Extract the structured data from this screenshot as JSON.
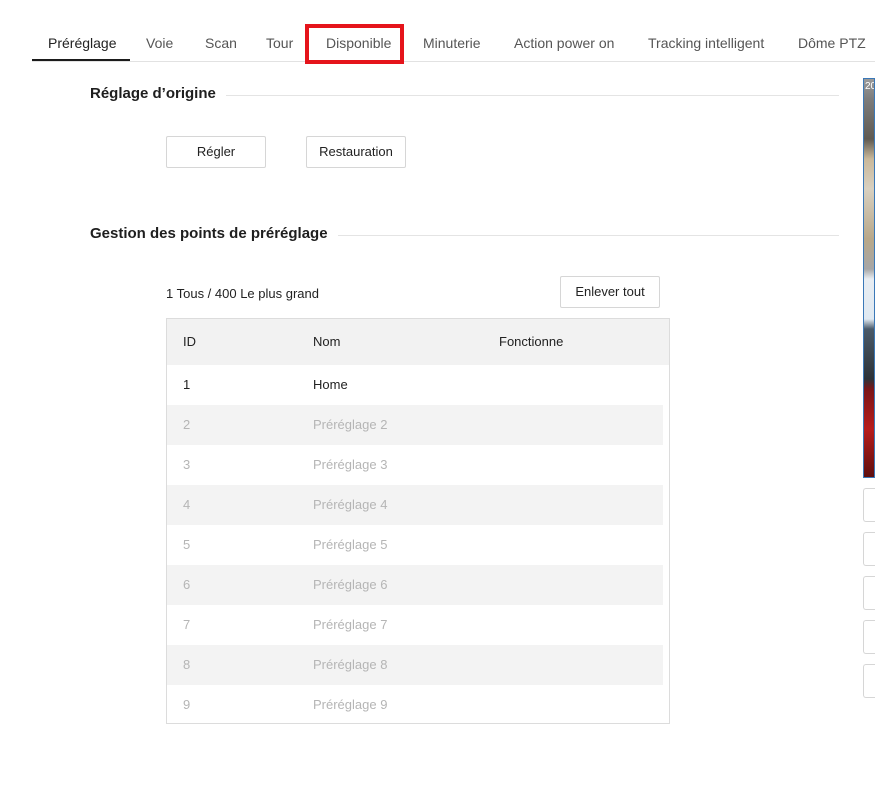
{
  "tabs": [
    {
      "label": "Préréglage",
      "active": true
    },
    {
      "label": "Voie"
    },
    {
      "label": "Scan"
    },
    {
      "label": "Tour"
    },
    {
      "label": "Disponible"
    },
    {
      "label": "Minuterie"
    },
    {
      "label": "Action power on"
    },
    {
      "label": "Tracking intelligent"
    },
    {
      "label": "Dôme PTZ"
    }
  ],
  "origin_section": {
    "title": "Réglage d’origine",
    "set_button": "Régler",
    "restore_button": "Restauration"
  },
  "preset_section": {
    "title": "Gestion des points de préréglage",
    "count_text": "1 Tous / 400 Le plus grand",
    "remove_all_button": "Enlever tout",
    "columns": {
      "id": "ID",
      "name": "Nom",
      "function": "Fonctionne"
    },
    "rows": [
      {
        "id": "1",
        "name": "Home",
        "enabled": true
      },
      {
        "id": "2",
        "name": "Préréglage 2",
        "enabled": false
      },
      {
        "id": "3",
        "name": "Préréglage 3",
        "enabled": false
      },
      {
        "id": "4",
        "name": "Préréglage 4",
        "enabled": false
      },
      {
        "id": "5",
        "name": "Préréglage 5",
        "enabled": false
      },
      {
        "id": "6",
        "name": "Préréglage 6",
        "enabled": false
      },
      {
        "id": "7",
        "name": "Préréglage 7",
        "enabled": false
      },
      {
        "id": "8",
        "name": "Préréglage 8",
        "enabled": false
      },
      {
        "id": "9",
        "name": "Préréglage 9",
        "enabled": false
      }
    ]
  },
  "preview": {
    "overlay_text": "20"
  },
  "colors": {
    "highlight": "#e5141b",
    "active_tab_underline": "#1b1b1b",
    "disabled_text": "#b5b5b5"
  }
}
